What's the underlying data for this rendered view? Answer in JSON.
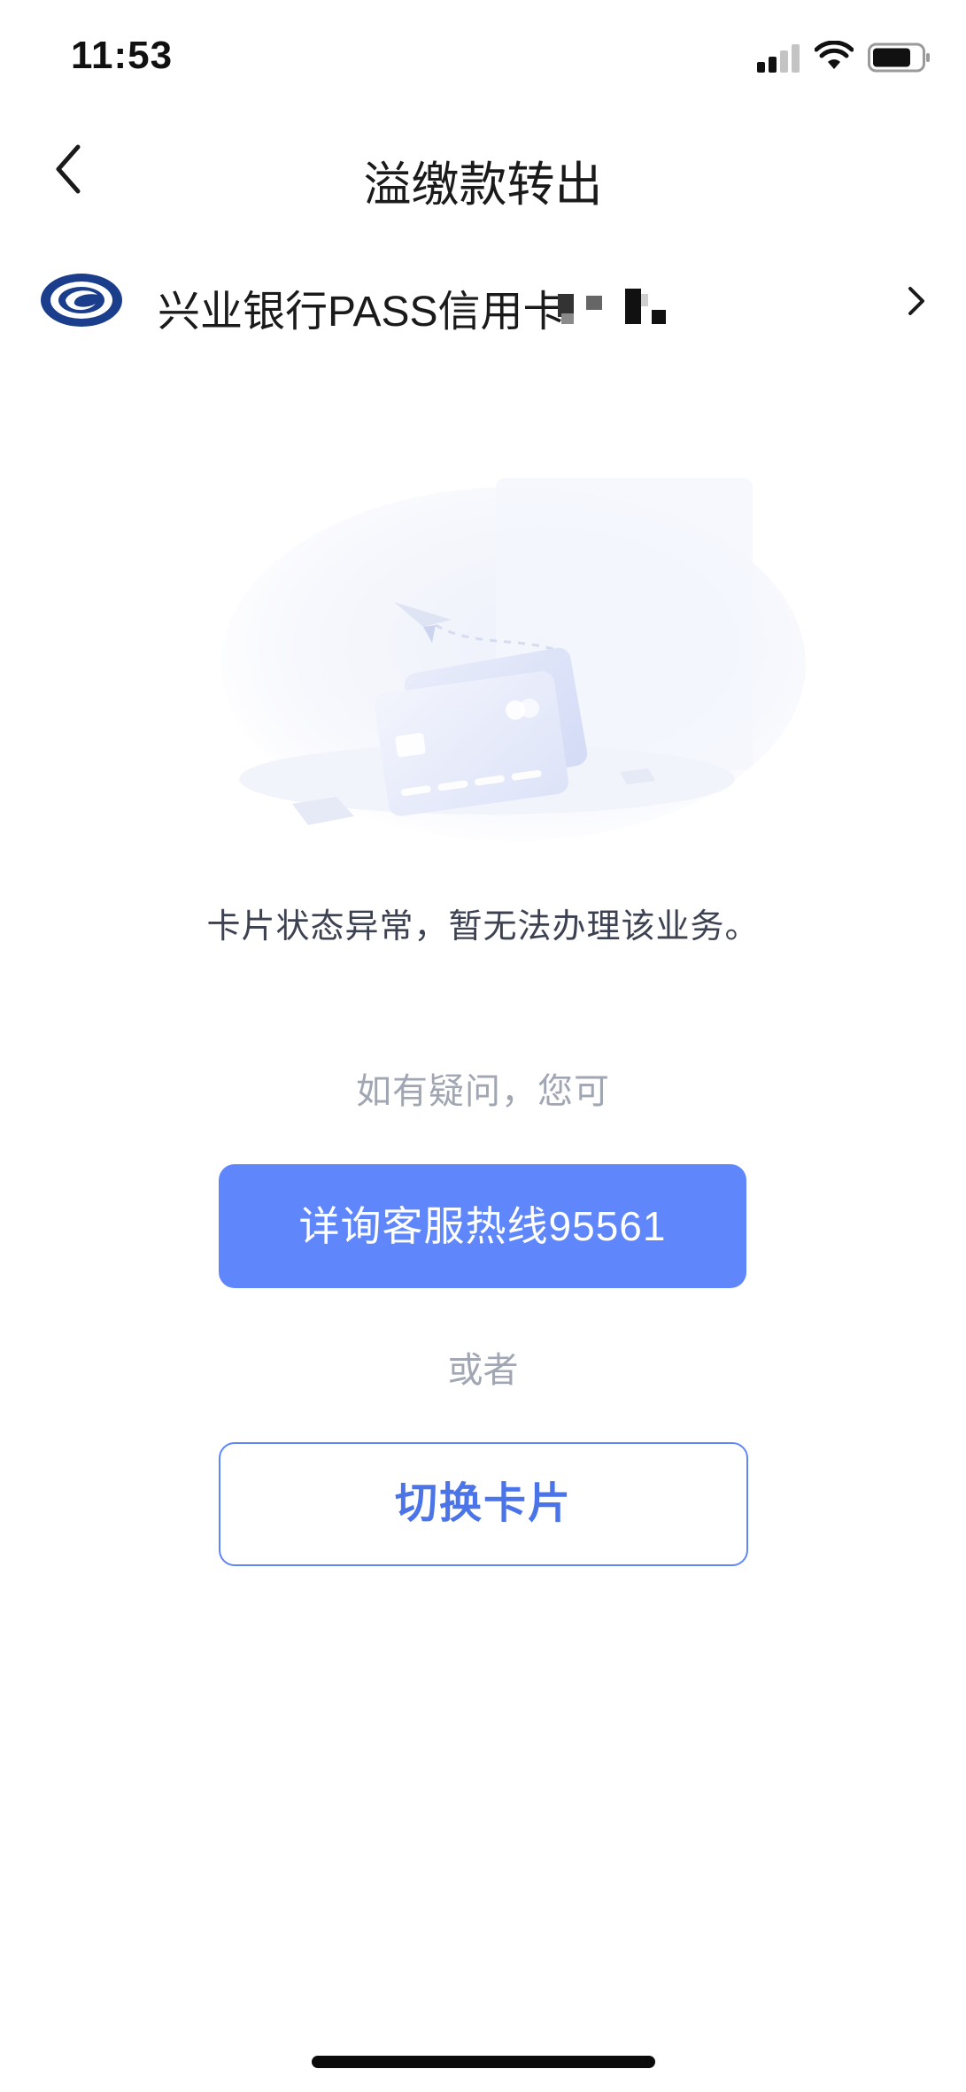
{
  "status_bar": {
    "time": "11:53"
  },
  "nav": {
    "title": "溢缴款转出",
    "back_icon": "chevron-left-icon"
  },
  "card": {
    "bank_logo": "cib-bank-logo",
    "name": "兴业银行PASS信用卡",
    "chevron_icon": "chevron-right-icon"
  },
  "illustration": {
    "icon": "credit-card-illustration"
  },
  "message": {
    "status": "卡片状态异常，暂无法办理该业务。",
    "hint": "如有疑问，您可",
    "or": "或者"
  },
  "buttons": {
    "hotline_label": "详询客服热线95561",
    "switch_card_label": "切换卡片"
  },
  "colors": {
    "primary": "#5f87fb",
    "bank_blue": "#1b3e8c",
    "hint_gray": "#a1a6b3"
  }
}
